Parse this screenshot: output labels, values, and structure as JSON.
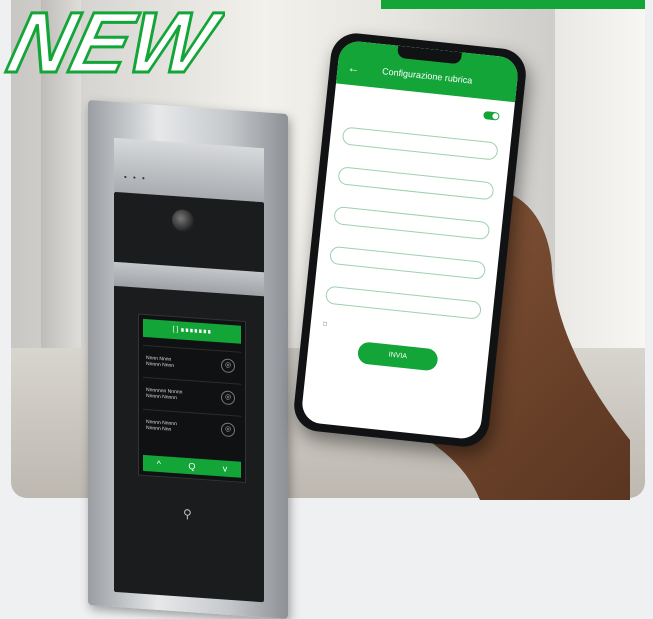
{
  "badge": {
    "text": "NEW",
    "color": "#13a538"
  },
  "colors": {
    "accent": "#13a538"
  },
  "intercom": {
    "leds": "• • •",
    "header": "[ ] ∎∎∎∎∎∎∎",
    "rows": [
      {
        "name": "Nnnn Nnnn\nNnnnn Nnnn",
        "icon": "bell-icon"
      },
      {
        "name": "Nnnnnnn Nnnnn\nNnnnn Nnnnn",
        "icon": "bell-icon"
      },
      {
        "name": "Nnnnn Nnnnn\nNnnnn Nnn",
        "icon": "bell-icon"
      }
    ],
    "nav": [
      "^",
      "Q",
      "v"
    ],
    "nfc_icon": "nfc-icon"
  },
  "phone": {
    "title": "Configurazione rubrica",
    "fields": [
      {
        "label": "",
        "value": ""
      },
      {
        "label": "",
        "value": ""
      },
      {
        "label": "",
        "value": ""
      },
      {
        "label": "",
        "value": ""
      },
      {
        "label": "",
        "value": ""
      }
    ],
    "button": "INVIA"
  }
}
